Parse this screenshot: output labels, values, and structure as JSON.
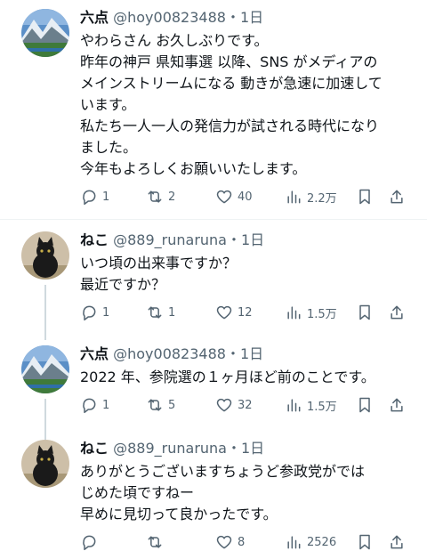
{
  "tweets": [
    {
      "name": "六点",
      "handle": "@hoy00823488",
      "time": "・1日",
      "avatar": "mountain-landscape",
      "lines": [
        "やわらさん お久しぶりです。",
        " 昨年の神戸 県知事選 以降、SNS がメディアの",
        "メインストリームになる 動きが急速に加速して",
        "います。",
        "私たち一人一人の発信力が試される時代になり",
        "ました。",
        "今年もよろしくお願いいたします。"
      ],
      "replies": "1",
      "retweets": "2",
      "likes": "40",
      "views": "2.2万"
    },
    {
      "name": "ねこ",
      "handle": "@889_runaruna",
      "time": "・1日",
      "avatar": "black-cat",
      "lines": [
        "いつ頃の出来事ですか？",
        "最近ですか？"
      ],
      "replies": "1",
      "retweets": "1",
      "likes": "12",
      "views": "1.5万"
    },
    {
      "name": "六点",
      "handle": "@hoy00823488",
      "time": "・1日",
      "avatar": "mountain-landscape",
      "lines": [
        "2022 年、参院選の１ヶ月ほど前のことです。"
      ],
      "replies": "1",
      "retweets": "5",
      "likes": "32",
      "views": "1.5万"
    },
    {
      "name": "ねこ",
      "handle": "@889_runaruna",
      "time": "・1日",
      "avatar": "black-cat",
      "lines": [
        "ありがとうございますちょうど参政党がでは",
        "じめた頃ですねー",
        "早めに見切って良かったです。"
      ],
      "replies": "",
      "retweets": "",
      "likes": "8",
      "views": "2526"
    }
  ],
  "colors": {
    "text": "#0f1419",
    "secondary": "#536471",
    "thread_line": "#cfd9de"
  }
}
